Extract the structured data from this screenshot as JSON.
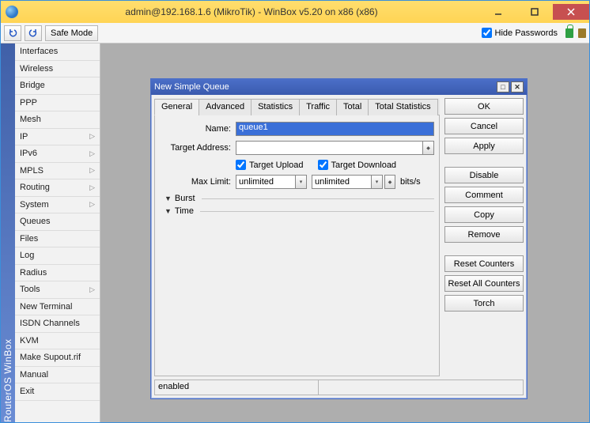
{
  "window": {
    "title": "admin@192.168.1.6 (MikroTik) - WinBox v5.20 on x86 (x86)"
  },
  "toolbar": {
    "safe_mode": "Safe Mode",
    "hide_passwords": "Hide Passwords"
  },
  "sidestrip": "RouterOS WinBox",
  "sidebar": {
    "items": [
      {
        "label": "Interfaces",
        "sub": false
      },
      {
        "label": "Wireless",
        "sub": false
      },
      {
        "label": "Bridge",
        "sub": false
      },
      {
        "label": "PPP",
        "sub": false
      },
      {
        "label": "Mesh",
        "sub": false
      },
      {
        "label": "IP",
        "sub": true
      },
      {
        "label": "IPv6",
        "sub": true
      },
      {
        "label": "MPLS",
        "sub": true
      },
      {
        "label": "Routing",
        "sub": true
      },
      {
        "label": "System",
        "sub": true
      },
      {
        "label": "Queues",
        "sub": false
      },
      {
        "label": "Files",
        "sub": false
      },
      {
        "label": "Log",
        "sub": false
      },
      {
        "label": "Radius",
        "sub": false
      },
      {
        "label": "Tools",
        "sub": true
      },
      {
        "label": "New Terminal",
        "sub": false
      },
      {
        "label": "ISDN Channels",
        "sub": false
      },
      {
        "label": "KVM",
        "sub": false
      },
      {
        "label": "Make Supout.rif",
        "sub": false
      },
      {
        "label": "Manual",
        "sub": false
      },
      {
        "label": "Exit",
        "sub": false
      }
    ]
  },
  "dialog": {
    "title": "New Simple Queue",
    "tabs": [
      "General",
      "Advanced",
      "Statistics",
      "Traffic",
      "Total",
      "Total Statistics"
    ],
    "active_tab": 0,
    "form": {
      "name_label": "Name:",
      "name_value": "queue1",
      "target_address_label": "Target Address:",
      "target_address_value": "",
      "target_upload_label": "Target Upload",
      "target_download_label": "Target Download",
      "max_limit_label": "Max Limit:",
      "max_limit_upload": "unlimited",
      "max_limit_download": "unlimited",
      "max_limit_unit": "bits/s",
      "burst_label": "Burst",
      "time_label": "Time"
    },
    "buttons": {
      "ok": "OK",
      "cancel": "Cancel",
      "apply": "Apply",
      "disable": "Disable",
      "comment": "Comment",
      "copy": "Copy",
      "remove": "Remove",
      "reset_counters": "Reset Counters",
      "reset_all": "Reset All Counters",
      "torch": "Torch"
    },
    "status": "enabled"
  }
}
